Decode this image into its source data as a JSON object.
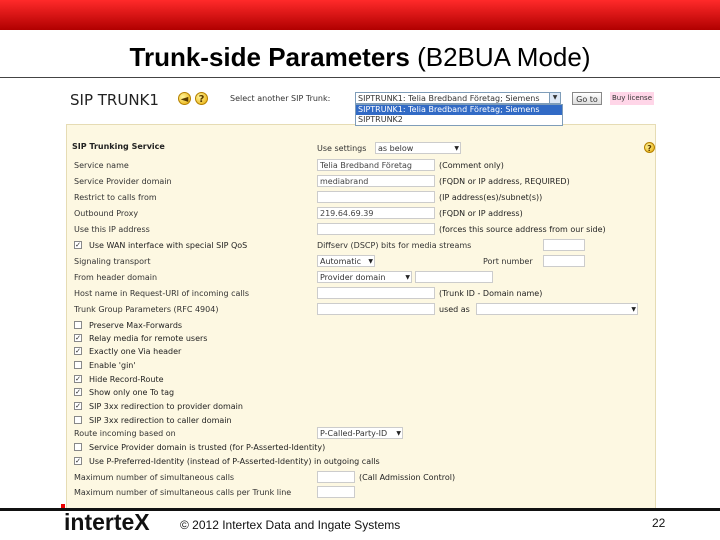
{
  "slide": {
    "title_bold": "Trunk-side Parameters",
    "title_rest": " (B2BUA Mode)",
    "copyright": "© 2012 Intertex Data and Ingate Systems",
    "page_number": "22",
    "logo_text": "interte",
    "logo_x": "X"
  },
  "header": {
    "title": "SIP TRUNK1",
    "back_icon": "back-arrow-icon",
    "help_icon": "help-icon",
    "select_another_label": "Select another SIP Trunk:",
    "trunk_selected": "SIPTRUNK1: Telia Bredband Företag; Siemens",
    "trunk_options": [
      "SIPTRUNK1: Telia Bredband Företag; Siemens",
      "SIPTRUNK2"
    ],
    "goto_label": "Go to",
    "buy_label": "Buy license"
  },
  "service": {
    "heading": "SIP Trunking Service",
    "use_settings_label": "Use settings",
    "use_settings_value": "as below"
  },
  "fields": [
    {
      "label": "Service name",
      "value": "Telia Bredband Företag",
      "hint": "(Comment only)"
    },
    {
      "label": "Service Provider domain",
      "value": "mediabrand",
      "hint": "(FQDN or IP address, REQUIRED)"
    },
    {
      "label": "Restrict to calls from",
      "value": "",
      "hint": "(IP address(es)/subnet(s))"
    },
    {
      "label": "Outbound Proxy",
      "value": "219.64.69.39",
      "hint": "(FQDN or IP address)"
    },
    {
      "label": "Use this IP address",
      "value": "",
      "hint": "(forces this source address from our side)"
    }
  ],
  "wan_row": {
    "label": "Use WAN interface with special SIP QoS",
    "checked": "✓",
    "diffserv_label": "Diffserv (DSCP) bits for media streams"
  },
  "transport": {
    "label": "Signaling transport",
    "value": "Automatic",
    "port_label": "Port number"
  },
  "from_header": {
    "label": "From header domain",
    "value": "Provider domain"
  },
  "host_name": {
    "label": "Host name in Request-URI of incoming calls",
    "hint": "(Trunk ID - Domain name)"
  },
  "trunk_group": {
    "label": "Trunk Group Parameters (RFC 4904)",
    "used_as": "used as"
  },
  "checkboxes": [
    {
      "label": "Preserve Max-Forwards",
      "checked": ""
    },
    {
      "label": "Relay media for remote users",
      "checked": "✓"
    },
    {
      "label": "Exactly one Via header",
      "checked": "✓"
    },
    {
      "label": "Enable 'gin'",
      "checked": ""
    },
    {
      "label": "Hide Record-Route",
      "checked": "✓"
    },
    {
      "label": "Show only one To tag",
      "checked": "✓"
    },
    {
      "label": "SIP 3xx redirection to provider domain",
      "checked": "✓"
    },
    {
      "label": "SIP 3xx redirection to caller domain",
      "checked": ""
    }
  ],
  "route_incoming": {
    "label": "Route incoming based on",
    "value": "P-Called-Party-ID"
  },
  "trust_checkboxes": [
    {
      "label": "Service Provider domain is trusted (for P-Asserted-Identity)",
      "checked": ""
    },
    {
      "label": "Use P-Preferred-Identity (instead of P-Asserted-Identity) in outgoing calls",
      "checked": "✓"
    }
  ],
  "max_calls": {
    "label1": "Maximum number of simultaneous calls",
    "hint1": "(Call Admission Control)",
    "label2": "Maximum number of simultaneous calls per Trunk line"
  },
  "colors": {
    "topbar": "#d00000",
    "panel": "#fdf8e2",
    "selection": "#316ac5"
  }
}
